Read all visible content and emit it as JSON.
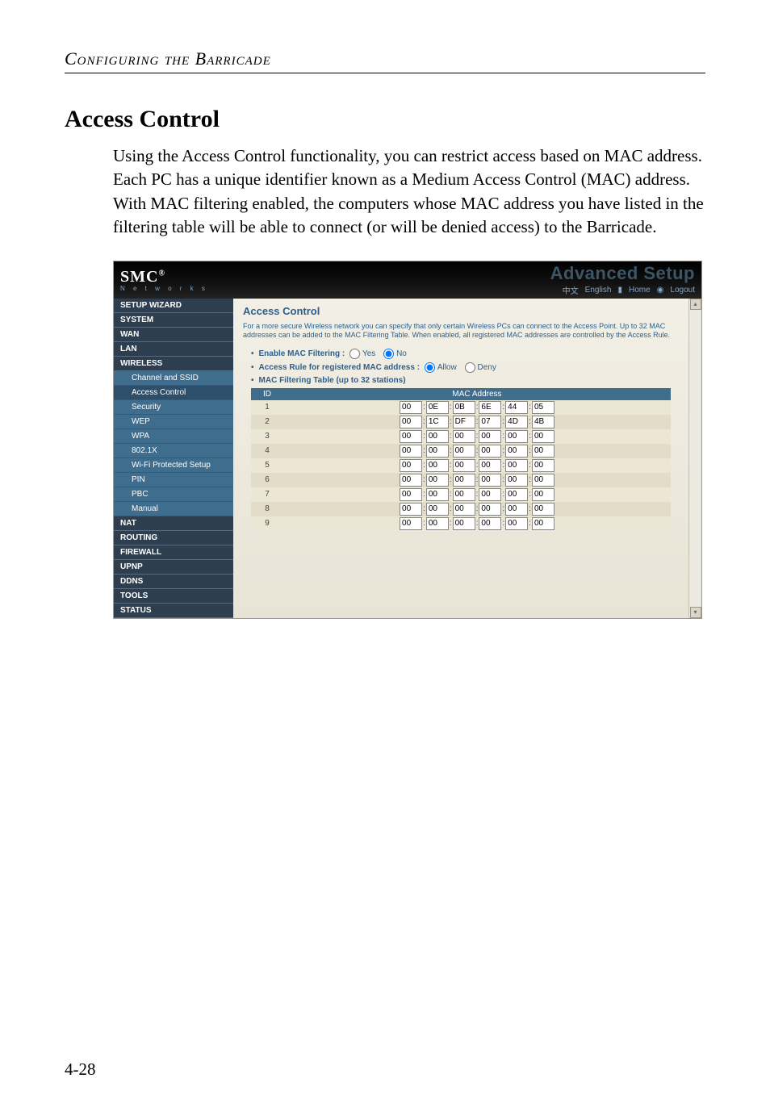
{
  "page": {
    "header": "Configuring the Barricade",
    "number": "4-28"
  },
  "section": {
    "title": "Access Control",
    "body": "Using the Access Control functionality, you can restrict access based on MAC address. Each PC has a unique identifier known as a Medium Access Control (MAC) address. With MAC filtering enabled, the computers whose MAC address you have listed in the filtering table will be able to connect (or will be denied access) to the Barricade."
  },
  "ui": {
    "brand": "SMC",
    "brand_reg": "®",
    "brand_sub": "N e t w o r k s",
    "adv": "Advanced Setup",
    "toplinks": {
      "zh": "中文",
      "en": "English",
      "home": "Home",
      "logout": "Logout"
    },
    "sidebar": [
      {
        "label": "SETUP WIZARD",
        "type": "dark"
      },
      {
        "label": "SYSTEM",
        "type": "dark"
      },
      {
        "label": "WAN",
        "type": "dark"
      },
      {
        "label": "LAN",
        "type": "dark"
      },
      {
        "label": "WIRELESS",
        "type": "dark"
      },
      {
        "label": "Channel and SSID",
        "type": "sub"
      },
      {
        "label": "Access Control",
        "type": "sub",
        "active": true
      },
      {
        "label": "Security",
        "type": "sub"
      },
      {
        "label": "WEP",
        "type": "sub"
      },
      {
        "label": "WPA",
        "type": "sub"
      },
      {
        "label": "802.1X",
        "type": "sub"
      },
      {
        "label": "Wi-Fi Protected Setup",
        "type": "sub"
      },
      {
        "label": "PIN",
        "type": "sub"
      },
      {
        "label": "PBC",
        "type": "sub"
      },
      {
        "label": "Manual",
        "type": "sub"
      },
      {
        "label": "NAT",
        "type": "dark"
      },
      {
        "label": "ROUTING",
        "type": "dark"
      },
      {
        "label": "FIREWALL",
        "type": "dark"
      },
      {
        "label": "UPnP",
        "type": "dark"
      },
      {
        "label": "DDNS",
        "type": "dark"
      },
      {
        "label": "TOOLS",
        "type": "dark"
      },
      {
        "label": "STATUS",
        "type": "dark"
      }
    ],
    "content": {
      "title": "Access Control",
      "desc": "For a more secure Wireless network you can specify that only certain Wireless PCs can connect to the Access Point. Up to 32 MAC addresses can be added to the MAC Filtering Table. When enabled, all registered MAC addresses are controlled by the Access Rule.",
      "enable_label": "Enable MAC Filtering :",
      "enable_yes": "Yes",
      "enable_no": "No",
      "rule_label": "Access Rule for registered MAC address :",
      "rule_allow": "Allow",
      "rule_deny": "Deny",
      "table_label": "MAC Filtering Table (up to 32 stations)",
      "th_id": "ID",
      "th_mac": "MAC Address",
      "rows": [
        {
          "id": "1",
          "mac": [
            "00",
            "0E",
            "0B",
            "6E",
            "44",
            "05"
          ]
        },
        {
          "id": "2",
          "mac": [
            "00",
            "1C",
            "DF",
            "07",
            "4D",
            "4B"
          ]
        },
        {
          "id": "3",
          "mac": [
            "00",
            "00",
            "00",
            "00",
            "00",
            "00"
          ]
        },
        {
          "id": "4",
          "mac": [
            "00",
            "00",
            "00",
            "00",
            "00",
            "00"
          ]
        },
        {
          "id": "5",
          "mac": [
            "00",
            "00",
            "00",
            "00",
            "00",
            "00"
          ]
        },
        {
          "id": "6",
          "mac": [
            "00",
            "00",
            "00",
            "00",
            "00",
            "00"
          ]
        },
        {
          "id": "7",
          "mac": [
            "00",
            "00",
            "00",
            "00",
            "00",
            "00"
          ]
        },
        {
          "id": "8",
          "mac": [
            "00",
            "00",
            "00",
            "00",
            "00",
            "00"
          ]
        },
        {
          "id": "9",
          "mac": [
            "00",
            "00",
            "00",
            "00",
            "00",
            "00"
          ]
        }
      ]
    }
  }
}
